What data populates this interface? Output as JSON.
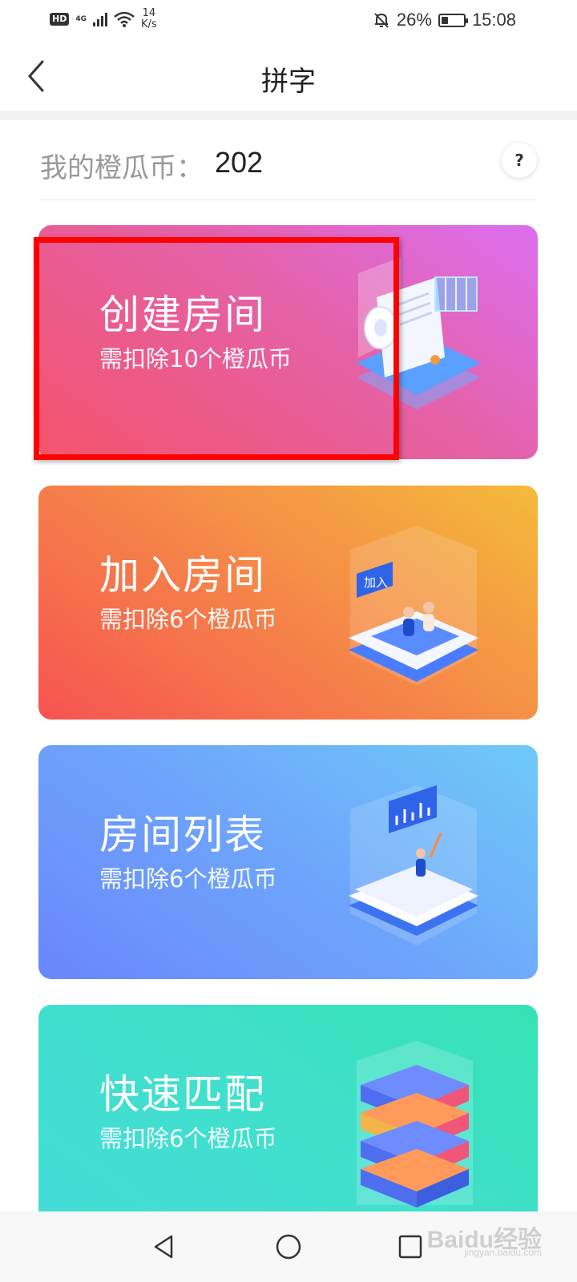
{
  "status_bar": {
    "hd": "HD",
    "network": "4G",
    "speed_value": "14",
    "speed_unit": "K/s",
    "battery": "26%",
    "time": "15:08",
    "battery_level": 0.26
  },
  "header": {
    "title": "拼字",
    "back_icon": "chevron-left-icon"
  },
  "coins": {
    "label": "我的橙瓜币：",
    "value": "202",
    "help": "?"
  },
  "cards": [
    {
      "title": "创建房间",
      "subtitle": "需扣除10个橙瓜币",
      "illustration": "document-roll-illustration"
    },
    {
      "title": "加入房间",
      "subtitle": "需扣除6个橙瓜币",
      "illustration": "join-phone-illustration",
      "badge": "加入"
    },
    {
      "title": "房间列表",
      "subtitle": "需扣除6个橙瓜币",
      "illustration": "chart-papers-illustration"
    },
    {
      "title": "快速匹配",
      "subtitle": "需扣除6个橙瓜币",
      "illustration": "server-stack-illustration"
    }
  ],
  "nav": {
    "back_icon": "triangle-back-icon",
    "home_icon": "circle-home-icon",
    "recents_icon": "square-recents-icon"
  },
  "watermark": {
    "text": "Baidu经验",
    "sub": "jingyan.baidu.com"
  },
  "colors": {
    "create": "#e561a6",
    "join": "#f58c47",
    "list": "#6ea8fb",
    "match": "#3fe0cb",
    "highlight": "#ff0000"
  }
}
